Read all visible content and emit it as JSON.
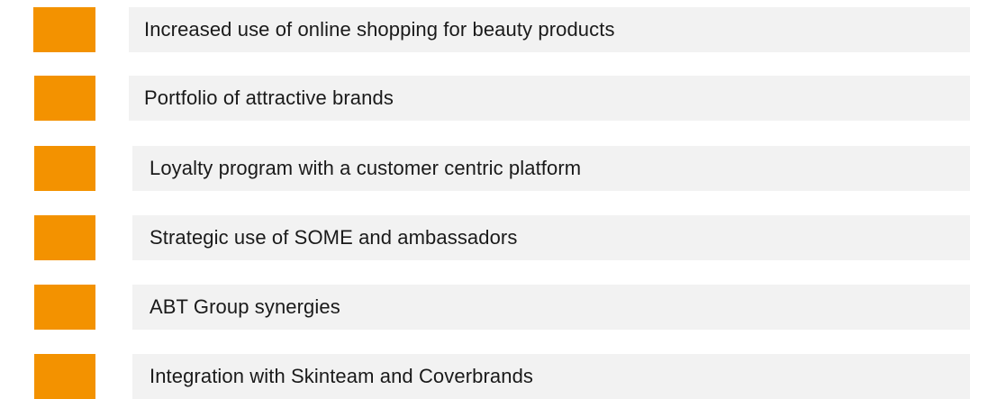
{
  "theme": {
    "accent_color": "#f39200",
    "bar_color": "#f2f2f2",
    "text_color": "#1a1a1a"
  },
  "items": [
    {
      "label": "Increased use of online shopping for beauty products"
    },
    {
      "label": "Portfolio of attractive brands"
    },
    {
      "label": "Loyalty program with a customer centric platform"
    },
    {
      "label": "Strategic use of SOME and ambassadors"
    },
    {
      "label": "ABT Group synergies"
    },
    {
      "label": "Integration with Skinteam and Coverbrands"
    }
  ]
}
